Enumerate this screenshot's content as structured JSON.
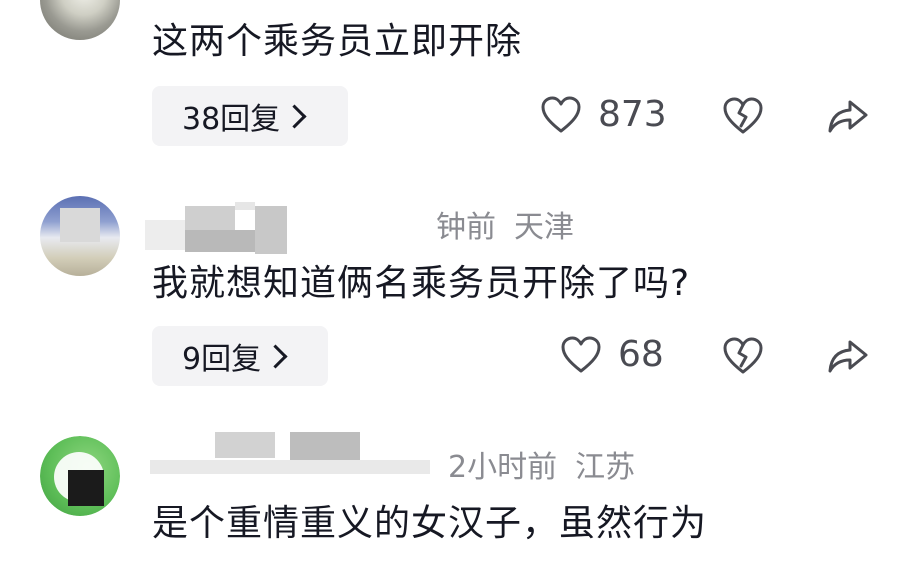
{
  "comments": [
    {
      "text": "这两个乘务员立即开除",
      "reply_label": "38回复",
      "likes": "873"
    },
    {
      "time": "钟前",
      "location": "天津",
      "text": "我就想知道俩名乘务员开除了吗?",
      "reply_label": "9回复",
      "likes": "68"
    },
    {
      "time": "2小时前",
      "location": "江苏",
      "text": "是个重情重义的女汉子，虽然行为"
    }
  ],
  "icons": {
    "like": "heart-outline-icon",
    "dislike": "broken-heart-icon",
    "share": "share-arrow-icon",
    "reply_more": "chevron-right-icon"
  },
  "colors": {
    "text": "#161823",
    "meta": "#8a8b91",
    "pill_bg": "#f3f3f5"
  }
}
